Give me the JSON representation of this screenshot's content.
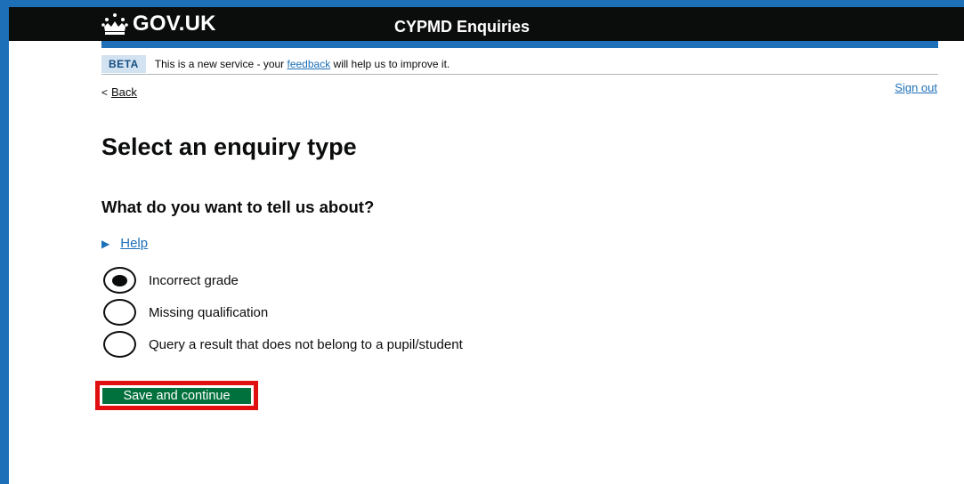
{
  "header": {
    "logo_text": "GOV.UK",
    "service_name": "CYPMD Enquiries"
  },
  "beta": {
    "tag": "BETA",
    "text_before": "This is a new service - your ",
    "link": "feedback",
    "text_after": " will help us to improve it."
  },
  "nav": {
    "back": "Back",
    "sign_out": "Sign out"
  },
  "page": {
    "title": "Select an enquiry type",
    "question": "What do you want to tell us about?",
    "help": "Help"
  },
  "options": [
    {
      "label": "Incorrect grade",
      "selected": true
    },
    {
      "label": "Missing qualification",
      "selected": false
    },
    {
      "label": "Query a result that does not belong to a pupil/student",
      "selected": false
    }
  ],
  "actions": {
    "save": "Save and continue"
  },
  "colors": {
    "header": "#0b0c0c",
    "brand_blue": "#1d70b8",
    "button_green": "#00703c",
    "highlight_red": "#e01010"
  }
}
